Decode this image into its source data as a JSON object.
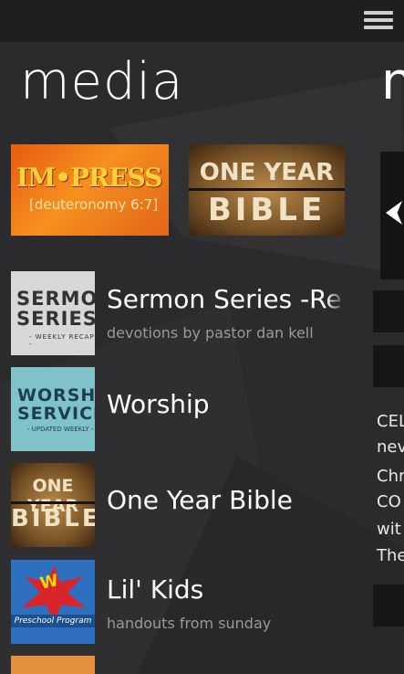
{
  "page": {
    "title": "media",
    "next_title": "n"
  },
  "header": {
    "menu_icon": "hamburger-menu-icon"
  },
  "featured": [
    {
      "id": "impress",
      "line1": "IM•PRESS",
      "line2": "[deuteronomy 6:7]"
    },
    {
      "id": "oneyear",
      "line1": "ONE YEAR",
      "line2": "BIBLE"
    }
  ],
  "list": [
    {
      "title": "Sermon Series -Re",
      "subtitle": "devotions by pastor dan kell",
      "thumb": {
        "l1": "SERMON",
        "l2": "SERIES",
        "l3": "- WEEKLY RECAP -"
      }
    },
    {
      "title": "Worship",
      "subtitle": "",
      "thumb": {
        "l1": "WORSHIP",
        "l2": "SERVICE",
        "l3": "- UPDATED WEEKLY -"
      }
    },
    {
      "title": "One Year Bible",
      "subtitle": "",
      "thumb": {
        "l1": "ONE YEAR",
        "l2": "BIBLE"
      }
    },
    {
      "title": "Lil' Kids",
      "subtitle": "handouts from sunday",
      "thumb": {
        "l1": "W",
        "l2": "Preschool Program"
      }
    }
  ],
  "next_panel": {
    "text_lines": [
      "CEL",
      "nev",
      "Chr",
      "CO",
      "wit",
      "The"
    ]
  },
  "colors": {
    "background": "#2b2a2c",
    "topbar": "#1f1e20",
    "subtitle": "#9a9a9a"
  }
}
